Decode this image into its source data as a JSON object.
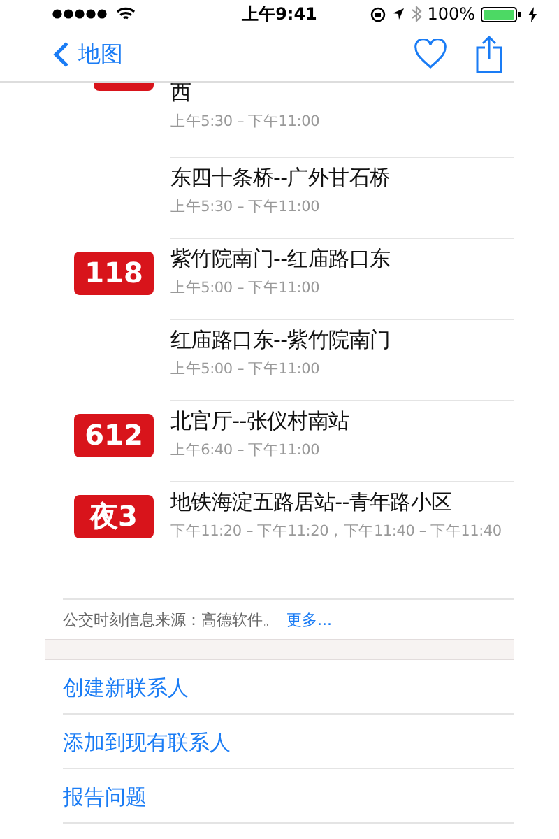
{
  "status_bar": {
    "time": "上午9:41",
    "battery": "100%"
  },
  "nav": {
    "back": "地图"
  },
  "routes": [
    {
      "kind": "stub",
      "title": "西",
      "hours": "上午5:30 – 下午11:00"
    },
    {
      "kind": "plain",
      "title": "东四十条桥--广外甘石桥",
      "hours": "上午5:30 – 下午11:00"
    },
    {
      "kind": "badge",
      "badge": "118",
      "title": "紫竹院南门--红庙路口东",
      "hours": "上午5:00 – 下午11:00"
    },
    {
      "kind": "plain",
      "title": "红庙路口东--紫竹院南门",
      "hours": "上午5:00 – 下午11:00"
    },
    {
      "kind": "badge",
      "badge": "612",
      "title": "北官厅--张仪村南站",
      "hours": "上午6:40 – 下午11:00"
    },
    {
      "kind": "badge",
      "badge": "夜3",
      "title": "地铁海淀五路居站--青年路小区",
      "hours": "下午11:20 – 下午11:20，下午11:40 – 下午11:40"
    }
  ],
  "source": {
    "text": "公交时刻信息来源：高德软件。",
    "link": "更多..."
  },
  "actions": [
    "创建新联系人",
    "添加到现有联系人",
    "报告问题"
  ]
}
